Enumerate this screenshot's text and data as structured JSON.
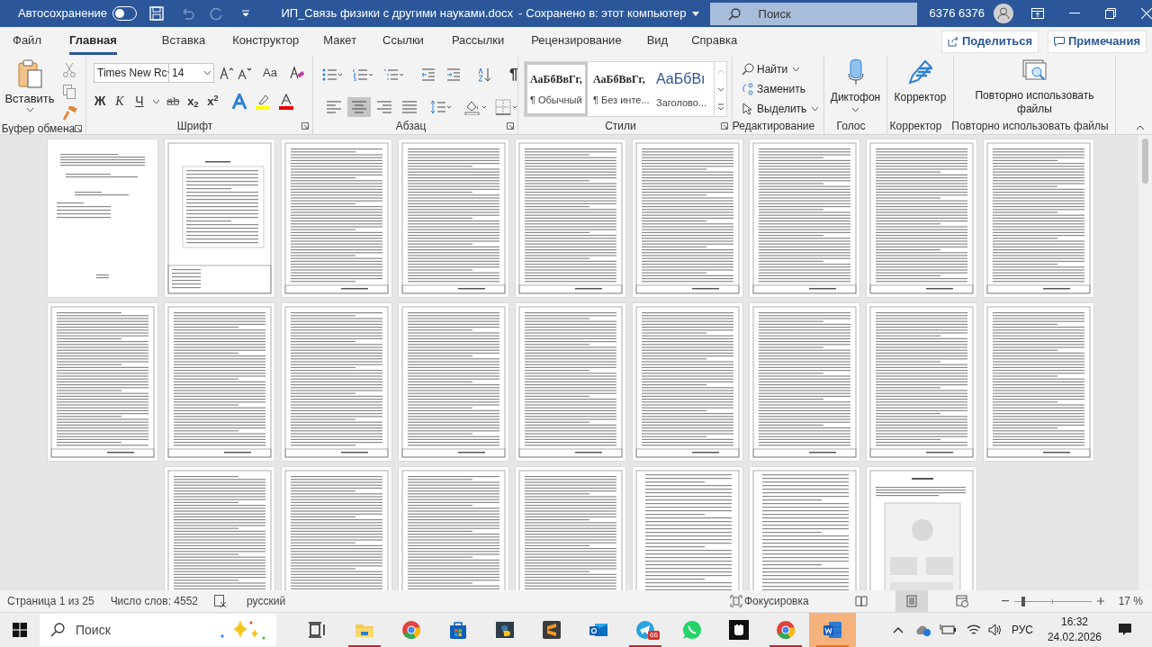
{
  "title_bar": {
    "autosave_label": "Автосохранение",
    "autosave_on": false,
    "document_title": "ИП_Связь физики с другими науками.docx",
    "title_separator": "-",
    "save_status": "Сохранено в: этот компьютер",
    "search_placeholder": "Поиск",
    "user_name": "6376 6376"
  },
  "tabs": [
    {
      "label": "Файл",
      "selected": false
    },
    {
      "label": "Главная",
      "selected": true
    },
    {
      "label": "Вставка",
      "selected": false
    },
    {
      "label": "Конструктор",
      "selected": false
    },
    {
      "label": "Макет",
      "selected": false
    },
    {
      "label": "Ссылки",
      "selected": false
    },
    {
      "label": "Рассылки",
      "selected": false
    },
    {
      "label": "Рецензирование",
      "selected": false
    },
    {
      "label": "Вид",
      "selected": false
    },
    {
      "label": "Справка",
      "selected": false
    }
  ],
  "share_button": "Поделиться",
  "comments_button": "Примечания",
  "ribbon": {
    "clipboard": {
      "label": "Буфер обмена",
      "paste": "Вставить"
    },
    "font": {
      "label": "Шрифт",
      "font_name": "Times New Rc",
      "font_size": "14",
      "case_button": "Aa",
      "format_buttons": [
        "Ж",
        "К",
        "Ч",
        "ab",
        "x$_{2}$",
        "x$^{2}$"
      ]
    },
    "paragraph": {
      "label": "Абзац",
      "alignments": [
        {
          "kind": "left",
          "selected": false
        },
        {
          "kind": "center",
          "selected": true
        },
        {
          "kind": "right",
          "selected": false
        },
        {
          "kind": "justify",
          "selected": false
        }
      ],
      "pilcrow": "¶"
    },
    "styles": {
      "label": "Стили",
      "items": [
        {
          "preview": "АаБбВвГг,",
          "name": "¶ Обычный",
          "kind": "normal",
          "selected": true
        },
        {
          "preview": "АаБбВвГг,",
          "name": "¶ Без инте...",
          "kind": "normal",
          "selected": false
        },
        {
          "preview": "АаБбВı",
          "name": "Заголово...",
          "kind": "heading",
          "selected": false
        }
      ]
    },
    "editing": {
      "label": "Редактирование",
      "find": "Найти",
      "replace": "Заменить",
      "select": "Выделить"
    },
    "voice": {
      "label": "Голос",
      "dictate": "Диктофон"
    },
    "editor": {
      "label": "Корректор",
      "button": "Корректор"
    },
    "reuse": {
      "label": "Повторно использовать файлы",
      "button": "Повторно использовать файлы"
    }
  },
  "document": {
    "pages": [
      {
        "kind": "title"
      },
      {
        "kind": "contents"
      },
      {
        "kind": "text"
      },
      {
        "kind": "text"
      },
      {
        "kind": "text"
      },
      {
        "kind": "text"
      },
      {
        "kind": "text"
      },
      {
        "kind": "text"
      },
      {
        "kind": "text"
      },
      {
        "kind": "text"
      },
      {
        "kind": "text"
      },
      {
        "kind": "text"
      },
      {
        "kind": "text"
      },
      {
        "kind": "text"
      },
      {
        "kind": "text"
      },
      {
        "kind": "text"
      },
      {
        "kind": "text"
      },
      {
        "kind": "text"
      },
      {
        "kind": "text"
      },
      {
        "kind": "text"
      },
      {
        "kind": "text"
      },
      {
        "kind": "text"
      },
      {
        "kind": "list"
      },
      {
        "kind": "list"
      },
      {
        "kind": "figure"
      }
    ]
  },
  "status_bar": {
    "page": "Страница 1 из 25",
    "words": "Число слов: 4552",
    "language": "русский",
    "focus": "Фокусировка",
    "views": [
      {
        "kind": "read",
        "selected": false
      },
      {
        "kind": "print",
        "selected": true
      },
      {
        "kind": "web",
        "selected": false
      }
    ],
    "zoom": {
      "level": 0.1,
      "reading": "17 %"
    }
  },
  "taskbar": {
    "search_placeholder": "Поиск",
    "apps": [
      {
        "kind": "taskview",
        "running": false,
        "selected": false
      },
      {
        "kind": "explorer",
        "running": true,
        "selected": false
      },
      {
        "kind": "chrome",
        "running": false,
        "selected": false
      },
      {
        "kind": "store",
        "running": false,
        "selected": false
      },
      {
        "kind": "python",
        "running": false,
        "selected": false
      },
      {
        "kind": "sublime",
        "running": false,
        "selected": false
      },
      {
        "kind": "outlook",
        "running": false,
        "selected": false
      },
      {
        "kind": "telegram",
        "running": true,
        "selected": false,
        "badge": "66"
      },
      {
        "kind": "whatsapp",
        "running": false,
        "selected": false
      },
      {
        "kind": "fist",
        "running": false,
        "selected": false
      },
      {
        "kind": "chrome",
        "running": true,
        "selected": false
      },
      {
        "kind": "word",
        "running": true,
        "selected": true
      }
    ],
    "language": "РУС",
    "time": "16:32",
    "date": "24.02.2026"
  }
}
